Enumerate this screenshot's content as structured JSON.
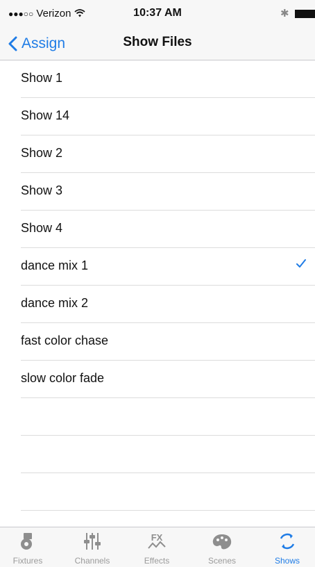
{
  "status_bar": {
    "carrier": "Verizon",
    "time": "10:37 AM"
  },
  "nav": {
    "back_label": "Assign",
    "title": "Show Files"
  },
  "files": [
    {
      "name": "Show 1",
      "selected": false
    },
    {
      "name": "Show 14",
      "selected": false
    },
    {
      "name": "Show 2",
      "selected": false
    },
    {
      "name": "Show 3",
      "selected": false
    },
    {
      "name": "Show 4",
      "selected": false
    },
    {
      "name": "dance mix 1",
      "selected": true
    },
    {
      "name": "dance mix 2",
      "selected": false
    },
    {
      "name": "fast color chase",
      "selected": false
    },
    {
      "name": "slow color fade",
      "selected": false
    }
  ],
  "tabs": [
    {
      "label": "Fixtures",
      "icon": "fixtures-icon"
    },
    {
      "label": "Channels",
      "icon": "channels-icon"
    },
    {
      "label": "Effects",
      "icon": "effects-icon"
    },
    {
      "label": "Scenes",
      "icon": "scenes-icon"
    },
    {
      "label": "Shows",
      "icon": "shows-icon",
      "active": true
    }
  ],
  "colors": {
    "accent": "#1f7ce6",
    "tab_inactive": "#9a9a9a"
  }
}
